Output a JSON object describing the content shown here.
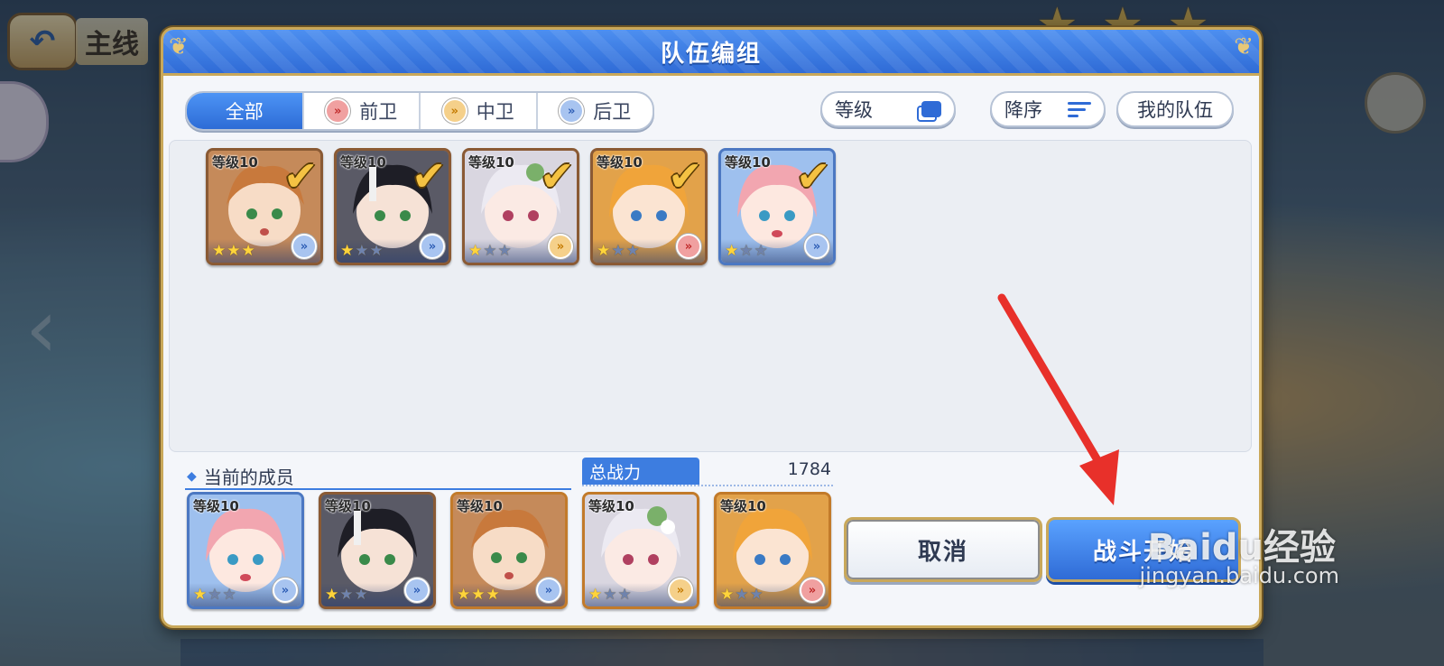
{
  "dialog": {
    "title": "队伍编组"
  },
  "filter_tabs": [
    {
      "label": "全部",
      "active": true
    },
    {
      "label": "前卫",
      "role": "front"
    },
    {
      "label": "中卫",
      "role": "mid"
    },
    {
      "label": "后卫",
      "role": "back"
    }
  ],
  "sort": {
    "level_label": "等级",
    "order_label": "降序",
    "my_team_label": "我的队伍"
  },
  "roster": [
    {
      "level": "等级10",
      "stars": 3,
      "frame": "bronze",
      "role": "back",
      "selected": true
    },
    {
      "level": "等级10",
      "stars": 1,
      "frame": "bronze",
      "role": "back",
      "selected": true
    },
    {
      "level": "等级10",
      "stars": 1,
      "frame": "bronze",
      "role": "mid",
      "selected": true
    },
    {
      "level": "等级10",
      "stars": 1,
      "frame": "bronze",
      "role": "front",
      "selected": true
    },
    {
      "level": "等级10",
      "stars": 1,
      "frame": "blue",
      "role": "back",
      "selected": true
    }
  ],
  "team": {
    "members_label": "当前的成员",
    "power_label": "总战力",
    "power_value": "1784",
    "members": [
      {
        "level": "等级10",
        "stars": 1,
        "frame": "blue",
        "role": "back"
      },
      {
        "level": "等级10",
        "stars": 1,
        "frame": "bronze",
        "role": "back"
      },
      {
        "level": "等级10",
        "stars": 3,
        "frame": "gold",
        "role": "back"
      },
      {
        "level": "等级10",
        "stars": 1,
        "frame": "gold",
        "role": "mid"
      },
      {
        "level": "等级10",
        "stars": 1,
        "frame": "gold",
        "role": "front"
      }
    ]
  },
  "actions": {
    "cancel_label": "取消",
    "start_label": "战斗开始"
  },
  "watermark": {
    "brand": "Baidu经验",
    "url": "jingyan.baidu.com"
  },
  "background": {
    "title_partial": "主线"
  },
  "colors": {
    "accent": "#2f6bd6",
    "gold_border": "#c9a85a",
    "check": "#f4c243",
    "arrow": "#e8302a"
  },
  "icons": {
    "check": "check-icon",
    "role_front": "vanguard-role-icon",
    "role_mid": "midguard-role-icon",
    "role_back": "rearguard-role-icon"
  }
}
